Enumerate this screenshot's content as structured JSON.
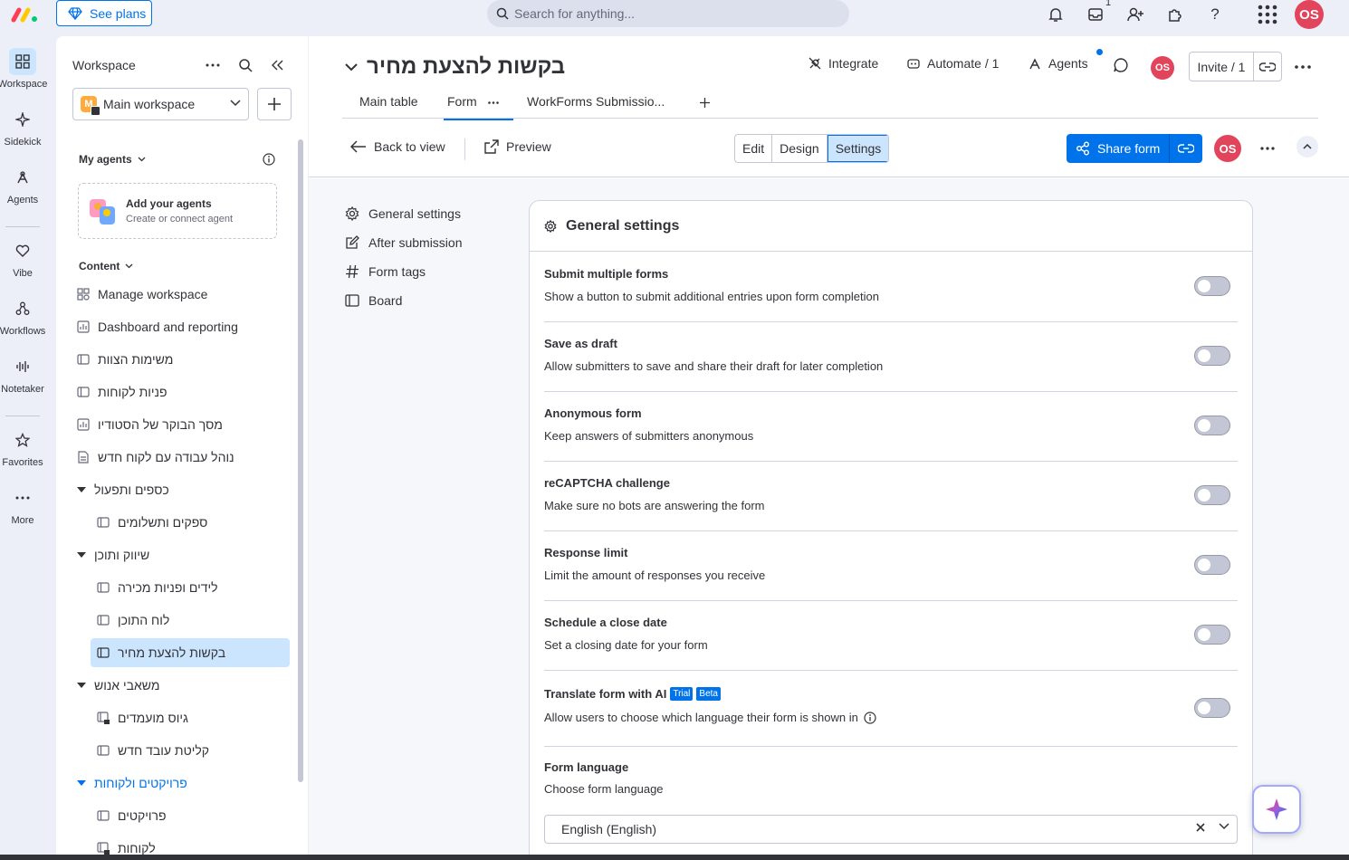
{
  "topbar": {
    "see_plans": "See plans",
    "search_placeholder": "Search for anything...",
    "inbox_count": "1",
    "user_initials": "OS"
  },
  "rail": {
    "items": [
      {
        "label": "Workspace"
      },
      {
        "label": "Sidekick"
      },
      {
        "label": "Agents"
      },
      {
        "label": "Vibe"
      },
      {
        "label": "Workflows"
      },
      {
        "label": "Notetaker"
      },
      {
        "label": "Favorites"
      },
      {
        "label": "More"
      }
    ]
  },
  "sidebar": {
    "title": "Workspace",
    "workspace_badge": "M",
    "workspace_name": "Main workspace",
    "my_agents": "My agents",
    "add_agents_title": "Add your agents",
    "add_agents_sub": "Create or connect agent",
    "content_label": "Content",
    "items": [
      {
        "label": "Manage workspace"
      },
      {
        "label": "Dashboard and reporting"
      },
      {
        "label": "משימות הצוות"
      },
      {
        "label": "פניות לקוחות"
      },
      {
        "label": "מסך הבוקר של הסטודיו"
      },
      {
        "label": "נוהל עבודה עם לקוח חדש"
      },
      {
        "label": "כספים ותפעול"
      },
      {
        "label": "ספקים ותשלומים"
      },
      {
        "label": "שיווק ותוכן"
      },
      {
        "label": "לידים ופניות מכירה"
      },
      {
        "label": "לוח התוכן"
      },
      {
        "label": "בקשות להצעת מחיר"
      },
      {
        "label": "משאבי אנוש"
      },
      {
        "label": "גיוס מועמדים"
      },
      {
        "label": "קליטת עובד חדש"
      },
      {
        "label": "פרויקטים ולקוחות"
      },
      {
        "label": "פרויקטים"
      },
      {
        "label": "לקוחות"
      }
    ]
  },
  "header": {
    "board_title": "בקשות להצעת מחיר",
    "integrate": "Integrate",
    "automate": "Automate / 1",
    "agents": "Agents",
    "invite": "Invite / 1",
    "user_initials": "OS"
  },
  "tabs": [
    {
      "label": "Main table"
    },
    {
      "label": "Form"
    },
    {
      "label": "WorkForms Submissio..."
    }
  ],
  "toolbar": {
    "back": "Back to view",
    "preview": "Preview",
    "modes": [
      "Edit",
      "Design",
      "Settings"
    ],
    "share": "Share form",
    "user_initials": "OS"
  },
  "settings_nav": [
    {
      "label": "General settings"
    },
    {
      "label": "After submission"
    },
    {
      "label": "Form tags"
    },
    {
      "label": "Board"
    }
  ],
  "card": {
    "title": "General settings",
    "settings": [
      {
        "title": "Submit multiple forms",
        "desc": "Show a button to submit additional entries upon form completion",
        "enabled": false
      },
      {
        "title": "Save as draft",
        "desc": "Allow submitters to save and share their draft for later completion",
        "enabled": false
      },
      {
        "title": "Anonymous form",
        "desc": "Keep answers of submitters anonymous",
        "enabled": false
      },
      {
        "title": "reCAPTCHA challenge",
        "desc": "Make sure no bots are answering the form",
        "enabled": false
      },
      {
        "title": "Response limit",
        "desc": "Limit the amount of responses you receive",
        "enabled": false
      },
      {
        "title": "Schedule a close date",
        "desc": "Set a closing date for your form",
        "enabled": false
      },
      {
        "title": "Translate form with AI",
        "desc": "Allow users to choose which language their form is shown in",
        "enabled": false,
        "badges": [
          "Trial",
          "Beta"
        ]
      }
    ],
    "language_title": "Form language",
    "language_desc": "Choose form language",
    "language_value": "English (English)"
  },
  "colors": {
    "accent": "#0073ea",
    "selected_bg": "#cce5ff",
    "avatar": "#e2445c",
    "workspace_badge": "#fdab3d"
  }
}
